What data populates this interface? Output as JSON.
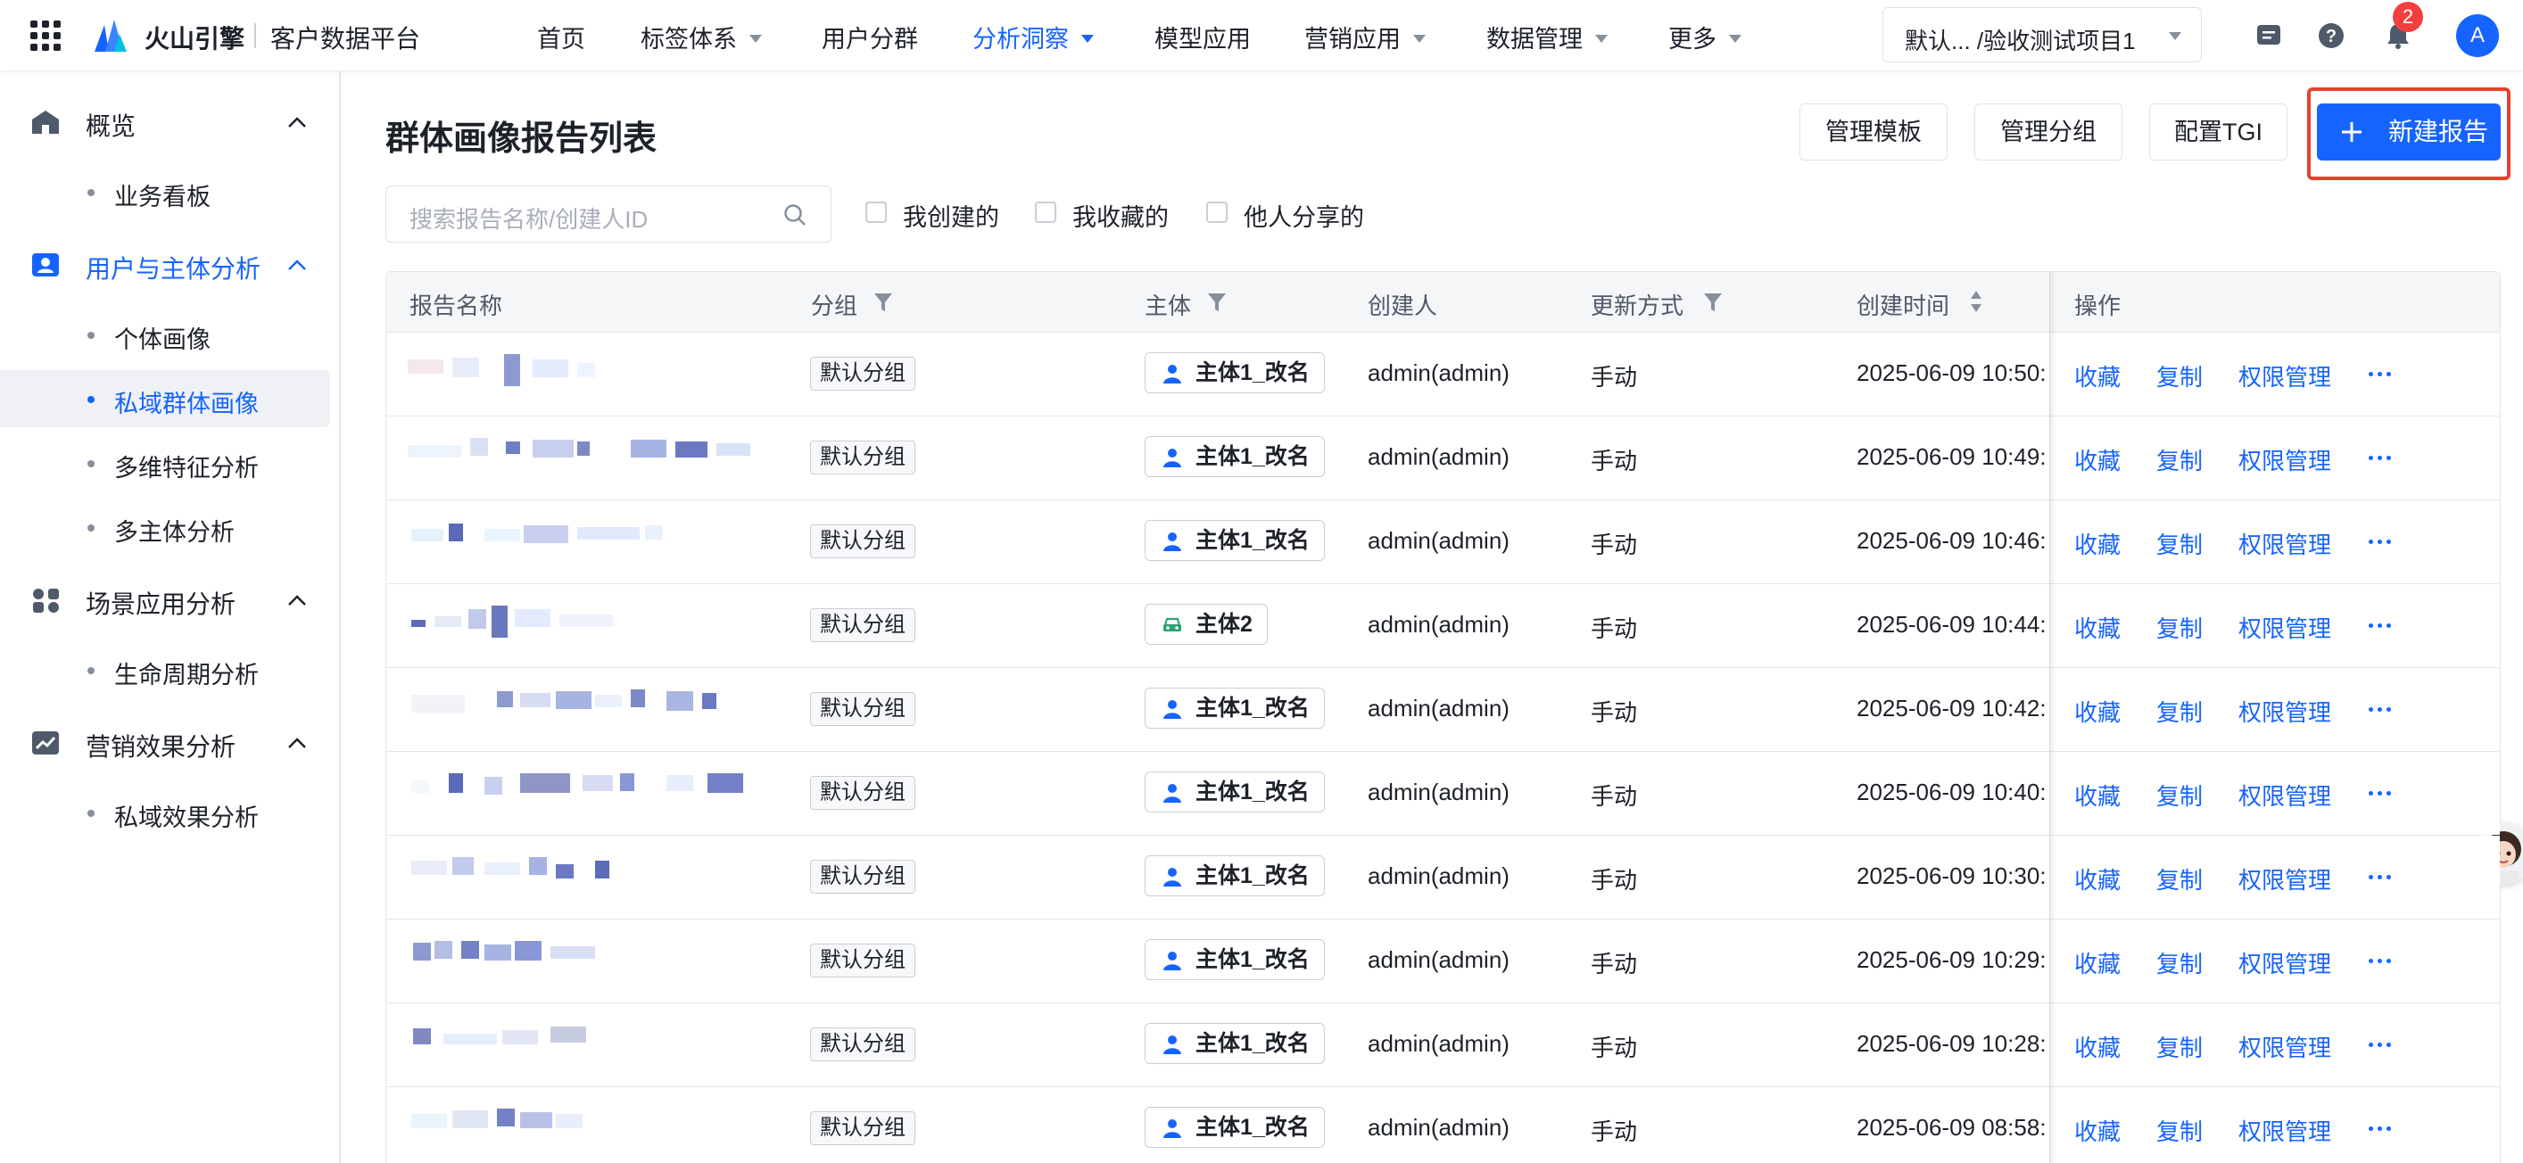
{
  "topnav": {
    "brand": "火山引擎",
    "product": "客户数据平台",
    "menu": [
      {
        "label": "首页"
      },
      {
        "label": "标签体系"
      },
      {
        "label": "用户分群"
      },
      {
        "label": "分析洞察"
      },
      {
        "label": "模型应用"
      },
      {
        "label": "营销应用"
      },
      {
        "label": "数据管理"
      },
      {
        "label": "更多"
      }
    ],
    "project_select": "默认...   /验收测试项目1",
    "notification_count": "2",
    "avatar_letter": "A"
  },
  "sidebar": {
    "groups": [
      {
        "label": "概览",
        "icon": "home-icon",
        "items": [
          "业务看板"
        ]
      },
      {
        "label": "用户与主体分析",
        "icon": "user-card-icon",
        "items": [
          "个体画像",
          "私域群体画像",
          "多维特征分析",
          "多主体分析"
        ]
      },
      {
        "label": "场景应用分析",
        "icon": "apps-icon",
        "items": [
          "生命周期分析"
        ]
      },
      {
        "label": "营销效果分析",
        "icon": "trend-chart-icon",
        "items": [
          "私域效果分析"
        ]
      }
    ]
  },
  "main": {
    "title": "群体画像报告列表",
    "buttons": {
      "manage_template": "管理模板",
      "manage_group": "管理分组",
      "config_tgi": "配置TGI",
      "new_report": "新建报告"
    },
    "search_placeholder": "搜索报告名称/创建人ID",
    "filters": [
      "我创建的",
      "我收藏的",
      "他人分享的"
    ],
    "table": {
      "columns": [
        "报告名称",
        "分组",
        "主体",
        "创建人",
        "更新方式",
        "创建时间",
        "操作"
      ],
      "rows": [
        {
          "group": "默认分组",
          "subject": "主体1_改名",
          "subject_icon": "person-icon",
          "creator": "admin(admin)",
          "update": "手动",
          "created": "2025-06-09 10:50:"
        },
        {
          "group": "默认分组",
          "subject": "主体1_改名",
          "subject_icon": "person-icon",
          "creator": "admin(admin)",
          "update": "手动",
          "created": "2025-06-09 10:49:"
        },
        {
          "group": "默认分组",
          "subject": "主体1_改名",
          "subject_icon": "person-icon",
          "creator": "admin(admin)",
          "update": "手动",
          "created": "2025-06-09 10:46:"
        },
        {
          "group": "默认分组",
          "subject": "主体2",
          "subject_icon": "car-icon",
          "creator": "admin(admin)",
          "update": "手动",
          "created": "2025-06-09 10:44:"
        },
        {
          "group": "默认分组",
          "subject": "主体1_改名",
          "subject_icon": "person-icon",
          "creator": "admin(admin)",
          "update": "手动",
          "created": "2025-06-09 10:42:"
        },
        {
          "group": "默认分组",
          "subject": "主体1_改名",
          "subject_icon": "person-icon",
          "creator": "admin(admin)",
          "update": "手动",
          "created": "2025-06-09 10:40:"
        },
        {
          "group": "默认分组",
          "subject": "主体1_改名",
          "subject_icon": "person-icon",
          "creator": "admin(admin)",
          "update": "手动",
          "created": "2025-06-09 10:30:"
        },
        {
          "group": "默认分组",
          "subject": "主体1_改名",
          "subject_icon": "person-icon",
          "creator": "admin(admin)",
          "update": "手动",
          "created": "2025-06-09 10:29:"
        },
        {
          "group": "默认分组",
          "subject": "主体1_改名",
          "subject_icon": "person-icon",
          "creator": "admin(admin)",
          "update": "手动",
          "created": "2025-06-09 10:28:"
        },
        {
          "group": "默认分组",
          "subject": "主体1_改名",
          "subject_icon": "person-icon",
          "creator": "admin(admin)",
          "update": "手动",
          "created": "2025-06-09 08:58:"
        }
      ],
      "actions": {
        "favorite": "收藏",
        "copy": "复制",
        "permission": "权限管理"
      }
    }
  },
  "colors": {
    "primary": "#1664ff",
    "highlight": "#e8402f",
    "car_icon": "#2ba471"
  }
}
